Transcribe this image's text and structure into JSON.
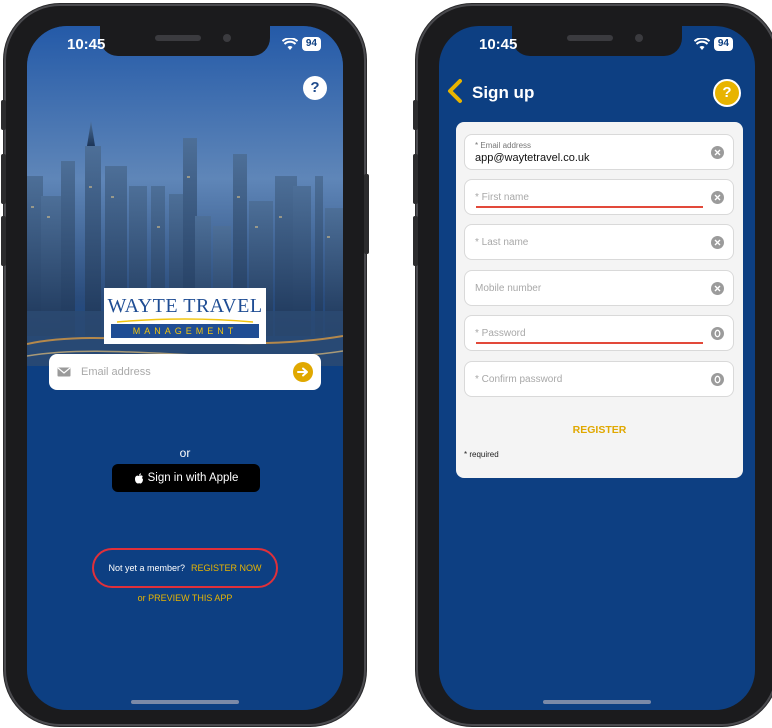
{
  "left_phone": {
    "status": {
      "time": "10:45",
      "battery": "94"
    },
    "help_label": "?",
    "logo": {
      "main": "WAYTE TRAVEL",
      "sub": "MANAGEMENT"
    },
    "email": {
      "placeholder": "Email address"
    },
    "or_label": "or",
    "apple_button_label": "Sign in with Apple",
    "not_member_label": "Not yet a member?",
    "register_now_label": "REGISTER NOW",
    "preview_label": "or PREVIEW THIS APP"
  },
  "right_phone": {
    "status": {
      "time": "10:45",
      "battery": "94"
    },
    "title": "Sign up",
    "help_label": "?",
    "fields": {
      "email": {
        "label": "* Email address",
        "value": "app@waytetravel.co.uk"
      },
      "first_name": {
        "placeholder": "* First name"
      },
      "last_name": {
        "placeholder": "* Last name"
      },
      "mobile": {
        "placeholder": "Mobile number"
      },
      "password": {
        "placeholder": "* Password"
      },
      "confirm_password": {
        "placeholder": "* Confirm password"
      }
    },
    "register_label": "REGISTER",
    "required_note": "* required"
  },
  "colors": {
    "app_blue": "#0d3f82",
    "accent_gold": "#e0a800",
    "error_red": "#e2493a",
    "highlight_ring": "#e0303a"
  },
  "icons": [
    "question-icon",
    "envelope-icon",
    "arrow-right-icon",
    "apple-icon",
    "chevron-left-icon",
    "clear-icon",
    "eye-icon",
    "wifi-icon",
    "battery-icon"
  ]
}
